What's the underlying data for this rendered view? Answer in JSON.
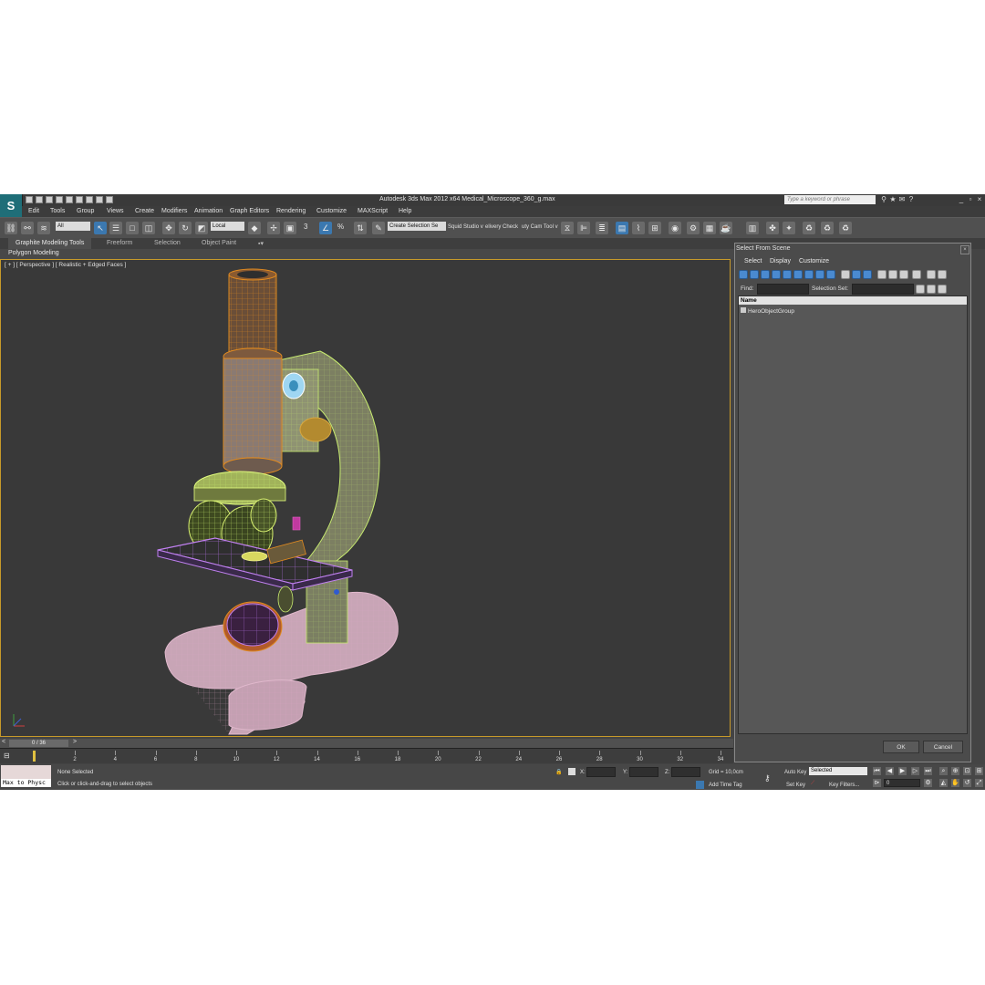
{
  "titlebar": {
    "title": "Autodesk 3ds Max  2012 x64     Medical_Microscope_360_g.max",
    "search_placeholder": "Type a keyword or phrase"
  },
  "menu": [
    "Edit",
    "Tools",
    "Group",
    "Views",
    "Create",
    "Modifiers",
    "Animation",
    "Graph Editors",
    "Rendering",
    "Customize",
    "MAXScript",
    "Help"
  ],
  "toolbar": {
    "filter_value": "All",
    "coord_value": "Local",
    "selection_set": "Create Selection Se",
    "plugin_1": "Squid Studio v",
    "plugin_2": "elivery Check",
    "plugin_3": "uty Cam Tool v",
    "snap_label": "3",
    "percent_label": "%"
  },
  "ribbon": {
    "tabs": [
      "Graphite Modeling Tools",
      "Freeform",
      "Selection",
      "Object Paint"
    ],
    "panel": "Polygon Modeling"
  },
  "viewport": {
    "label": "[ + ] [ Perspective ] [ Realistic + Edged Faces ]"
  },
  "timeline": {
    "frame": "0 / 36",
    "ticks": [
      "2",
      "4",
      "6",
      "8",
      "10",
      "12",
      "14",
      "16",
      "18",
      "20",
      "22",
      "24",
      "26",
      "28",
      "30",
      "32",
      "34"
    ]
  },
  "status": {
    "maxscript": "Max to Physc",
    "selection": "None Selected",
    "prompt": "Click or click-and-drag to select objects",
    "x_label": "X:",
    "y_label": "Y:",
    "z_label": "Z:",
    "grid": "Grid = 10,0cm",
    "add_time_tag": "Add Time Tag",
    "auto_key": "Auto Key",
    "auto_key_mode": "Selected",
    "set_key": "Set Key",
    "key_filters": "Key Filters...",
    "frame_field": "0"
  },
  "dialog": {
    "title": "Select From Scene",
    "menu": [
      "Select",
      "Display",
      "Customize"
    ],
    "find_label": "Find:",
    "selection_set_label": "Selection Set:",
    "column": "Name",
    "items": [
      "HeroObjectGroup"
    ],
    "ok": "OK",
    "cancel": "Cancel"
  },
  "colors": {
    "accent": "#3b78b0",
    "viewport_border": "#c79a2a",
    "wire_orange": "#e08a20",
    "wire_green": "#b8e060",
    "wire_purple": "#b070e0"
  }
}
